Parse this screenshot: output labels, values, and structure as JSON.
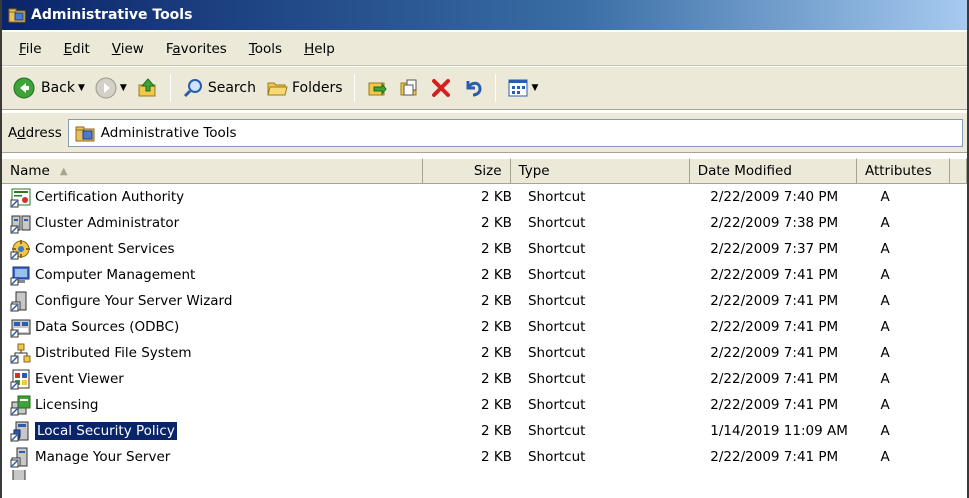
{
  "window": {
    "title": "Administrative Tools"
  },
  "menu": [
    {
      "key": "F",
      "rest": "ile"
    },
    {
      "key": "E",
      "rest": "dit"
    },
    {
      "key": "V",
      "rest": "iew"
    },
    {
      "pre": "F",
      "key": "a",
      "rest": "vorites"
    },
    {
      "key": "T",
      "rest": "ools"
    },
    {
      "key": "H",
      "rest": "elp"
    }
  ],
  "toolbar": {
    "back_label": "Back",
    "search_label": "Search",
    "folders_label": "Folders"
  },
  "address": {
    "label_pre": "A",
    "label_key": "d",
    "label_rest": "dress",
    "value": "Administrative Tools"
  },
  "columns": {
    "name": "Name",
    "size": "Size",
    "type": "Type",
    "date": "Date Modified",
    "attributes": "Attributes"
  },
  "rows": [
    {
      "name": "Certification Authority",
      "size": "2 KB",
      "type": "Shortcut",
      "date": "2/22/2009 7:40 PM",
      "attr": "A",
      "icon": "certificate-icon"
    },
    {
      "name": "Cluster Administrator",
      "size": "2 KB",
      "type": "Shortcut",
      "date": "2/22/2009 7:38 PM",
      "attr": "A",
      "icon": "cluster-icon"
    },
    {
      "name": "Component Services",
      "size": "2 KB",
      "type": "Shortcut",
      "date": "2/22/2009 7:37 PM",
      "attr": "A",
      "icon": "component-services-icon"
    },
    {
      "name": "Computer Management",
      "size": "2 KB",
      "type": "Shortcut",
      "date": "2/22/2009 7:41 PM",
      "attr": "A",
      "icon": "computer-management-icon"
    },
    {
      "name": "Configure Your Server Wizard",
      "size": "2 KB",
      "type": "Shortcut",
      "date": "2/22/2009 7:41 PM",
      "attr": "A",
      "icon": "server-wizard-icon"
    },
    {
      "name": "Data Sources (ODBC)",
      "size": "2 KB",
      "type": "Shortcut",
      "date": "2/22/2009 7:41 PM",
      "attr": "A",
      "icon": "odbc-icon"
    },
    {
      "name": "Distributed File System",
      "size": "2 KB",
      "type": "Shortcut",
      "date": "2/22/2009 7:41 PM",
      "attr": "A",
      "icon": "dfs-icon"
    },
    {
      "name": "Event Viewer",
      "size": "2 KB",
      "type": "Shortcut",
      "date": "2/22/2009 7:41 PM",
      "attr": "A",
      "icon": "event-viewer-icon"
    },
    {
      "name": "Licensing",
      "size": "2 KB",
      "type": "Shortcut",
      "date": "2/22/2009 7:41 PM",
      "attr": "A",
      "icon": "licensing-icon"
    },
    {
      "name": "Local Security Policy",
      "size": "2 KB",
      "type": "Shortcut",
      "date": "1/14/2019 11:09 AM",
      "attr": "A",
      "icon": "security-policy-icon",
      "selected": true
    },
    {
      "name": "Manage Your Server",
      "size": "2 KB",
      "type": "Shortcut",
      "date": "2/22/2009 7:41 PM",
      "attr": "A",
      "icon": "manage-server-icon"
    }
  ],
  "colors": {
    "selection": "#0a246a",
    "chrome": "#ece9d8",
    "titlebar": "#0a246a"
  }
}
